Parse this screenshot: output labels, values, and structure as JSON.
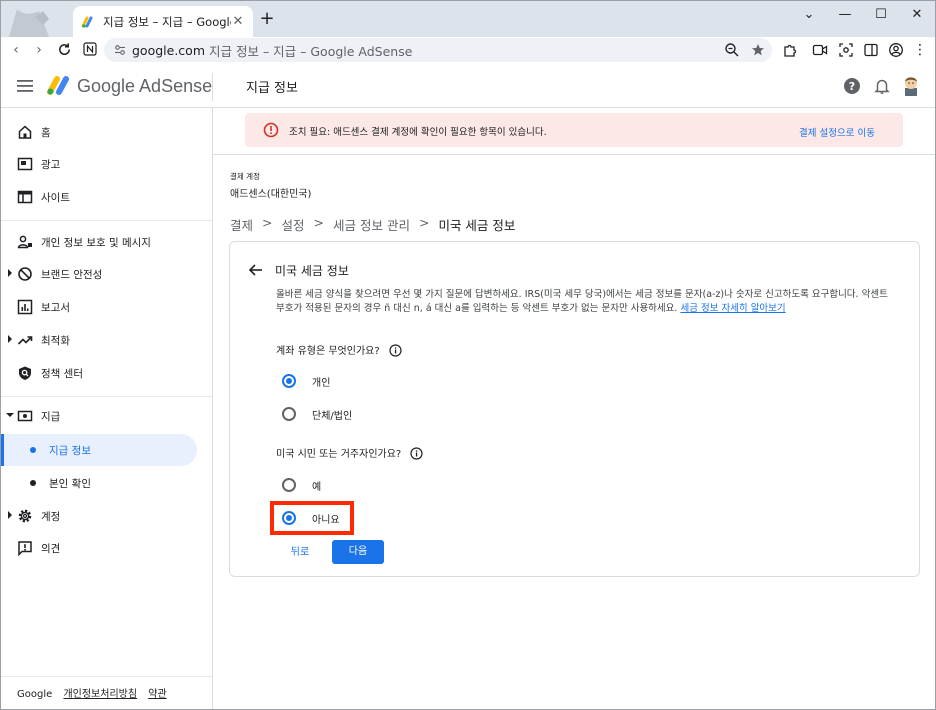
{
  "browser": {
    "tab_title": "지급 정보 – 지급 – Google AdSense",
    "url_host": "google.com",
    "url_rest": "지급 정보 – 지급 – Google AdSense"
  },
  "header": {
    "brand": "Google AdSense",
    "page_title": "지급 정보"
  },
  "sidebar": {
    "items": [
      {
        "label": "홈",
        "icon": "home-icon"
      },
      {
        "label": "광고",
        "icon": "ads-icon"
      },
      {
        "label": "사이트",
        "icon": "sites-icon"
      },
      {
        "label": "개인 정보 보호 및 메시지",
        "icon": "privacy-icon"
      },
      {
        "label": "브랜드 안전성",
        "icon": "block-icon"
      },
      {
        "label": "보고서",
        "icon": "reports-icon"
      },
      {
        "label": "최적화",
        "icon": "trending-icon"
      },
      {
        "label": "정책 센터",
        "icon": "policy-shield-icon"
      },
      {
        "label": "지급",
        "icon": "payments-icon"
      },
      {
        "label": "지급 정보",
        "icon": "dot"
      },
      {
        "label": "본인 확인",
        "icon": "dot"
      },
      {
        "label": "계정",
        "icon": "gear-icon"
      },
      {
        "label": "의견",
        "icon": "feedback-icon"
      }
    ],
    "footer": {
      "google": "Google",
      "privacy": "개인정보처리방침",
      "terms": "약관"
    }
  },
  "alert": {
    "message": "조치 필요: 애드센스 결제 계정에 확인이 필요한 항목이 있습니다.",
    "action": "결제 설정으로 이동"
  },
  "account": {
    "label": "결제 계정",
    "name": "애드센스(대한민국)"
  },
  "breadcrumb": [
    "결제",
    ">",
    "설정",
    ">",
    "세금 정보 관리",
    ">",
    "미국 세금 정보"
  ],
  "card": {
    "title": "미국 세금 정보",
    "description": "올바른 세금 양식을 찾으려면 우선 몇 가지 질문에 답변하세요. IRS(미국 세무 당국)에서는 세금 정보를 문자(a-z)나 숫자로 신고하도록 요구합니다. 악센트 부호가 적용된 문자의 경우 ñ 대신 n, á 대신 a를 입력하는 등 악센트 부호가 없는 문자만 사용하세요.",
    "learn_more": "세금 정보 자세히 알아보기",
    "q1": {
      "label": "계좌 유형은 무엇인가요?",
      "options": [
        "개인",
        "단체/법인"
      ],
      "selected": "개인"
    },
    "q2": {
      "label": "미국 시민 또는 거주자인가요?",
      "options": [
        "예",
        "아니요"
      ],
      "selected": "아니요"
    },
    "back": "뒤로",
    "next": "다음"
  },
  "colors": {
    "accent": "#1a73e8",
    "alert_bg": "#fce8e6",
    "highlight": "#ff2a00"
  }
}
